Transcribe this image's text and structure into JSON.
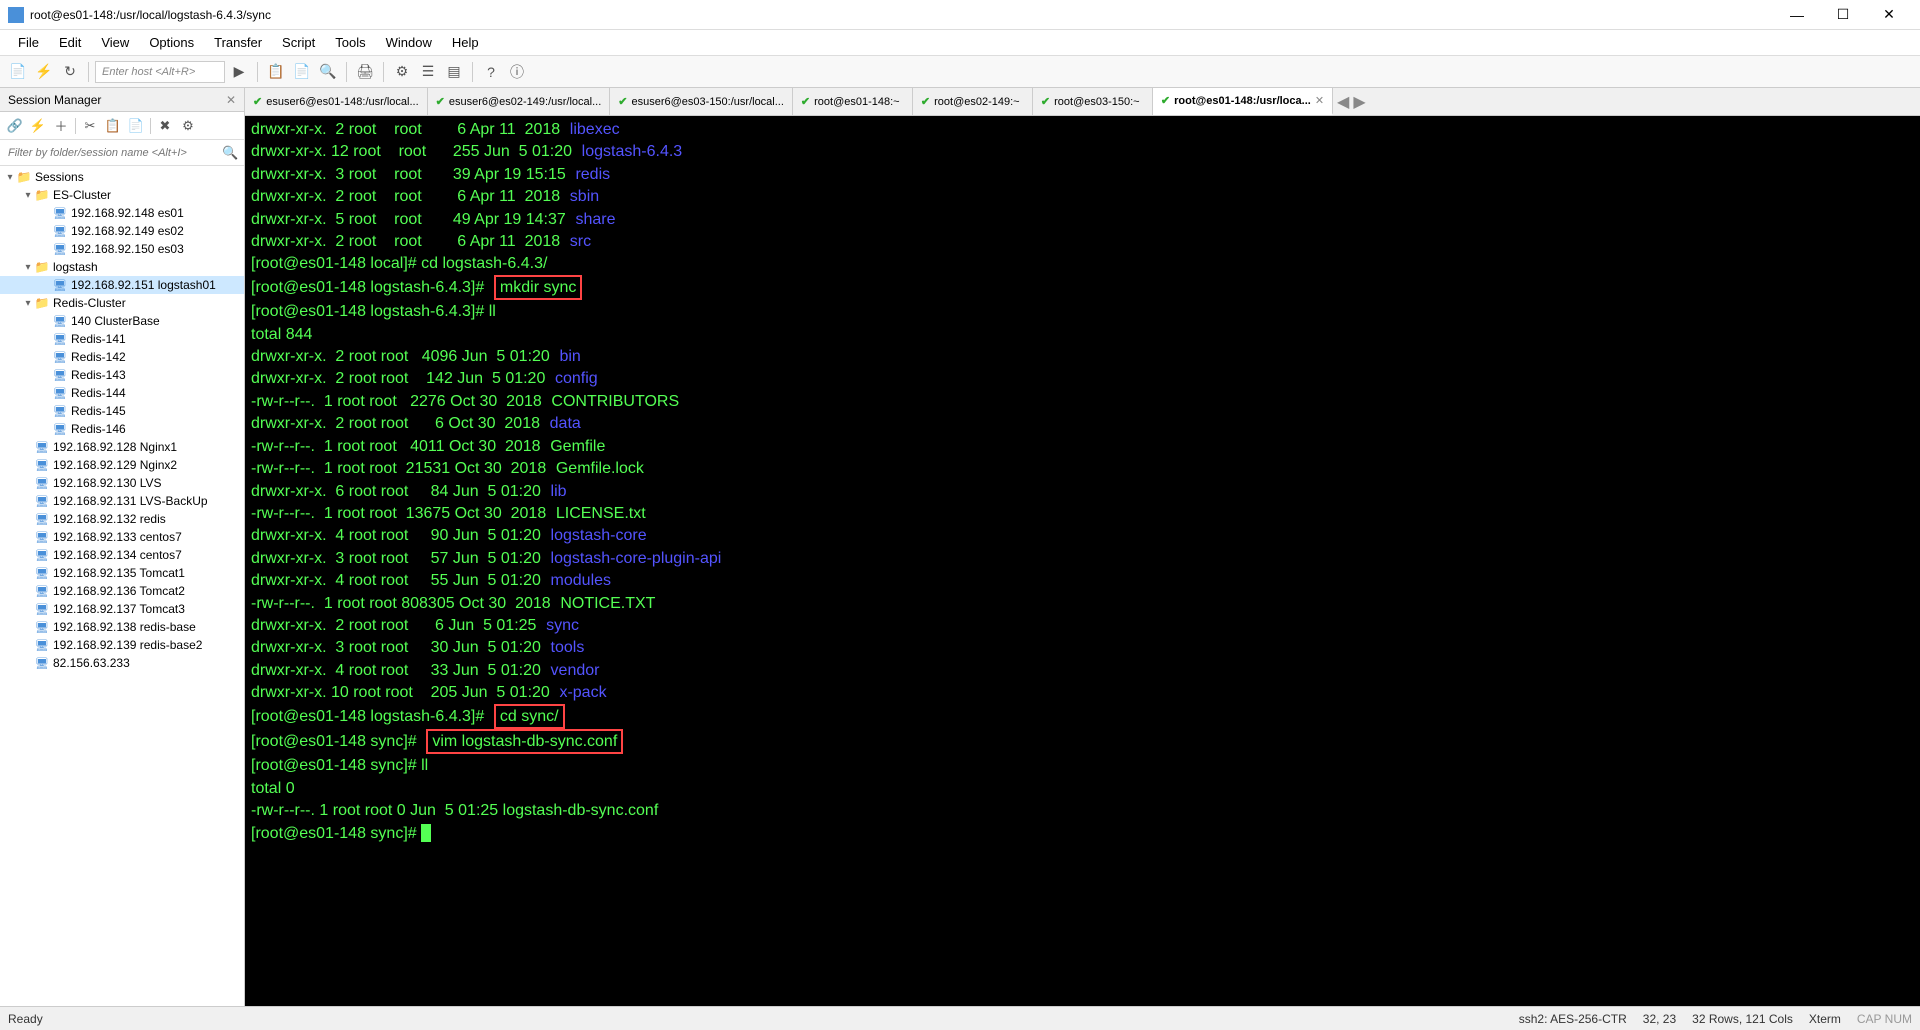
{
  "window": {
    "title": "root@es01-148:/usr/local/logstash-6.4.3/sync"
  },
  "menu": [
    "File",
    "Edit",
    "View",
    "Options",
    "Transfer",
    "Script",
    "Tools",
    "Window",
    "Help"
  ],
  "toolbar": {
    "host_placeholder": "Enter host <Alt+R>"
  },
  "sidebar": {
    "title": "Session Manager",
    "filter_placeholder": "Filter by folder/session name <Alt+I>",
    "tree": [
      {
        "level": 0,
        "type": "folder",
        "expanded": true,
        "label": "Sessions"
      },
      {
        "level": 1,
        "type": "folder",
        "expanded": true,
        "label": "ES-Cluster"
      },
      {
        "level": 2,
        "type": "host",
        "label": "192.168.92.148 es01"
      },
      {
        "level": 2,
        "type": "host",
        "label": "192.168.92.149 es02"
      },
      {
        "level": 2,
        "type": "host",
        "label": "192.168.92.150 es03"
      },
      {
        "level": 1,
        "type": "folder",
        "expanded": true,
        "label": "logstash"
      },
      {
        "level": 2,
        "type": "host",
        "label": "192.168.92.151 logstash01",
        "selected": true
      },
      {
        "level": 1,
        "type": "folder",
        "expanded": true,
        "label": "Redis-Cluster"
      },
      {
        "level": 2,
        "type": "host",
        "label": "140 ClusterBase"
      },
      {
        "level": 2,
        "type": "host",
        "label": "Redis-141"
      },
      {
        "level": 2,
        "type": "host",
        "label": "Redis-142"
      },
      {
        "level": 2,
        "type": "host",
        "label": "Redis-143"
      },
      {
        "level": 2,
        "type": "host",
        "label": "Redis-144"
      },
      {
        "level": 2,
        "type": "host",
        "label": "Redis-145"
      },
      {
        "level": 2,
        "type": "host",
        "label": "Redis-146"
      },
      {
        "level": 1,
        "type": "host",
        "label": "192.168.92.128  Nginx1"
      },
      {
        "level": 1,
        "type": "host",
        "label": "192.168.92.129  Nginx2"
      },
      {
        "level": 1,
        "type": "host",
        "label": "192.168.92.130  LVS"
      },
      {
        "level": 1,
        "type": "host",
        "label": "192.168.92.131  LVS-BackUp"
      },
      {
        "level": 1,
        "type": "host",
        "label": "192.168.92.132  redis"
      },
      {
        "level": 1,
        "type": "host",
        "label": "192.168.92.133  centos7"
      },
      {
        "level": 1,
        "type": "host",
        "label": "192.168.92.134  centos7"
      },
      {
        "level": 1,
        "type": "host",
        "label": "192.168.92.135  Tomcat1"
      },
      {
        "level": 1,
        "type": "host",
        "label": "192.168.92.136  Tomcat2"
      },
      {
        "level": 1,
        "type": "host",
        "label": "192.168.92.137  Tomcat3"
      },
      {
        "level": 1,
        "type": "host",
        "label": "192.168.92.138 redis-base"
      },
      {
        "level": 1,
        "type": "host",
        "label": "192.168.92.139 redis-base2"
      },
      {
        "level": 1,
        "type": "host",
        "label": "82.156.63.233"
      }
    ]
  },
  "tabs": [
    {
      "label": "esuser6@es01-148:/usr/local...",
      "active": false
    },
    {
      "label": "esuser6@es02-149:/usr/local...",
      "active": false
    },
    {
      "label": "esuser6@es03-150:/usr/local...",
      "active": false
    },
    {
      "label": "root@es01-148:~",
      "active": false
    },
    {
      "label": "root@es02-149:~",
      "active": false
    },
    {
      "label": "root@es03-150:~",
      "active": false
    },
    {
      "label": "root@es01-148:/usr/loca...",
      "active": true
    }
  ],
  "terminal": {
    "lines": [
      {
        "perm": "drwxr-xr-x.",
        "links": "2",
        "own": "root",
        "grp": "root",
        "size": "6",
        "date": "Apr 11  2018",
        "name": "libexec",
        "dir": true
      },
      {
        "perm": "drwxr-xr-x.",
        "links": "12",
        "own": "root",
        "grp": "root",
        "size": "255",
        "date": "Jun  5 01:20",
        "name": "logstash-6.4.3",
        "dir": true
      },
      {
        "perm": "drwxr-xr-x.",
        "links": "3",
        "own": "root",
        "grp": "root",
        "size": "39",
        "date": "Apr 19 15:15",
        "name": "redis",
        "dir": true
      },
      {
        "perm": "drwxr-xr-x.",
        "links": "2",
        "own": "root",
        "grp": "root",
        "size": "6",
        "date": "Apr 11  2018",
        "name": "sbin",
        "dir": true
      },
      {
        "perm": "drwxr-xr-x.",
        "links": "5",
        "own": "root",
        "grp": "root",
        "size": "49",
        "date": "Apr 19 14:37",
        "name": "share",
        "dir": true
      },
      {
        "perm": "drwxr-xr-x.",
        "links": "2",
        "own": "root",
        "grp": "root",
        "size": "6",
        "date": "Apr 11  2018",
        "name": "src",
        "dir": true
      }
    ],
    "prompt1_host": "[root@es01-148 local]#",
    "prompt1_cmd": "cd logstash-6.4.3/",
    "prompt2_host": "[root@es01-148 logstash-6.4.3]#",
    "prompt2_cmd": "mkdir sync",
    "prompt3_host": "[root@es01-148 logstash-6.4.3]#",
    "prompt3_cmd": "ll",
    "total1": "total 844",
    "lines2": [
      {
        "perm": "drwxr-xr-x.",
        "links": "2",
        "own": "root",
        "grp": "root",
        "size": "4096",
        "date": "Jun  5 01:20",
        "name": "bin",
        "dir": true
      },
      {
        "perm": "drwxr-xr-x.",
        "links": "2",
        "own": "root",
        "grp": "root",
        "size": "142",
        "date": "Jun  5 01:20",
        "name": "config",
        "dir": true
      },
      {
        "perm": "-rw-r--r--.",
        "links": "1",
        "own": "root",
        "grp": "root",
        "size": "2276",
        "date": "Oct 30  2018",
        "name": "CONTRIBUTORS",
        "dir": false
      },
      {
        "perm": "drwxr-xr-x.",
        "links": "2",
        "own": "root",
        "grp": "root",
        "size": "6",
        "date": "Oct 30  2018",
        "name": "data",
        "dir": true
      },
      {
        "perm": "-rw-r--r--.",
        "links": "1",
        "own": "root",
        "grp": "root",
        "size": "4011",
        "date": "Oct 30  2018",
        "name": "Gemfile",
        "dir": false
      },
      {
        "perm": "-rw-r--r--.",
        "links": "1",
        "own": "root",
        "grp": "root",
        "size": "21531",
        "date": "Oct 30  2018",
        "name": "Gemfile.lock",
        "dir": false
      },
      {
        "perm": "drwxr-xr-x.",
        "links": "6",
        "own": "root",
        "grp": "root",
        "size": "84",
        "date": "Jun  5 01:20",
        "name": "lib",
        "dir": true
      },
      {
        "perm": "-rw-r--r--.",
        "links": "1",
        "own": "root",
        "grp": "root",
        "size": "13675",
        "date": "Oct 30  2018",
        "name": "LICENSE.txt",
        "dir": false
      },
      {
        "perm": "drwxr-xr-x.",
        "links": "4",
        "own": "root",
        "grp": "root",
        "size": "90",
        "date": "Jun  5 01:20",
        "name": "logstash-core",
        "dir": true
      },
      {
        "perm": "drwxr-xr-x.",
        "links": "3",
        "own": "root",
        "grp": "root",
        "size": "57",
        "date": "Jun  5 01:20",
        "name": "logstash-core-plugin-api",
        "dir": true
      },
      {
        "perm": "drwxr-xr-x.",
        "links": "4",
        "own": "root",
        "grp": "root",
        "size": "55",
        "date": "Jun  5 01:20",
        "name": "modules",
        "dir": true
      },
      {
        "perm": "-rw-r--r--.",
        "links": "1",
        "own": "root",
        "grp": "root",
        "size": "808305",
        "date": "Oct 30  2018",
        "name": "NOTICE.TXT",
        "dir": false
      },
      {
        "perm": "drwxr-xr-x.",
        "links": "2",
        "own": "root",
        "grp": "root",
        "size": "6",
        "date": "Jun  5 01:25",
        "name": "sync",
        "dir": true
      },
      {
        "perm": "drwxr-xr-x.",
        "links": "3",
        "own": "root",
        "grp": "root",
        "size": "30",
        "date": "Jun  5 01:20",
        "name": "tools",
        "dir": true
      },
      {
        "perm": "drwxr-xr-x.",
        "links": "4",
        "own": "root",
        "grp": "root",
        "size": "33",
        "date": "Jun  5 01:20",
        "name": "vendor",
        "dir": true
      },
      {
        "perm": "drwxr-xr-x.",
        "links": "10",
        "own": "root",
        "grp": "root",
        "size": "205",
        "date": "Jun  5 01:20",
        "name": "x-pack",
        "dir": true
      }
    ],
    "prompt4_host": "[root@es01-148 logstash-6.4.3]#",
    "prompt4_cmd": "cd sync/",
    "prompt5_host": "[root@es01-148 sync]#",
    "prompt5_cmd": "vim logstash-db-sync.conf",
    "prompt6_host": "[root@es01-148 sync]#",
    "prompt6_cmd": "ll",
    "total2": "total 0",
    "line3": {
      "perm": "-rw-r--r--.",
      "links": "1",
      "own": "root",
      "grp": "root",
      "size": "0",
      "date": "Jun  5 01:25",
      "name": "logstash-db-sync.conf",
      "dir": false
    },
    "prompt7_host": "[root@es01-148 sync]#"
  },
  "status": {
    "left": "Ready",
    "ssh": "ssh2: AES-256-CTR",
    "pos": "32,  23",
    "rows": "32 Rows, 121 Cols",
    "term": "Xterm",
    "caps": "CAP NUM"
  }
}
